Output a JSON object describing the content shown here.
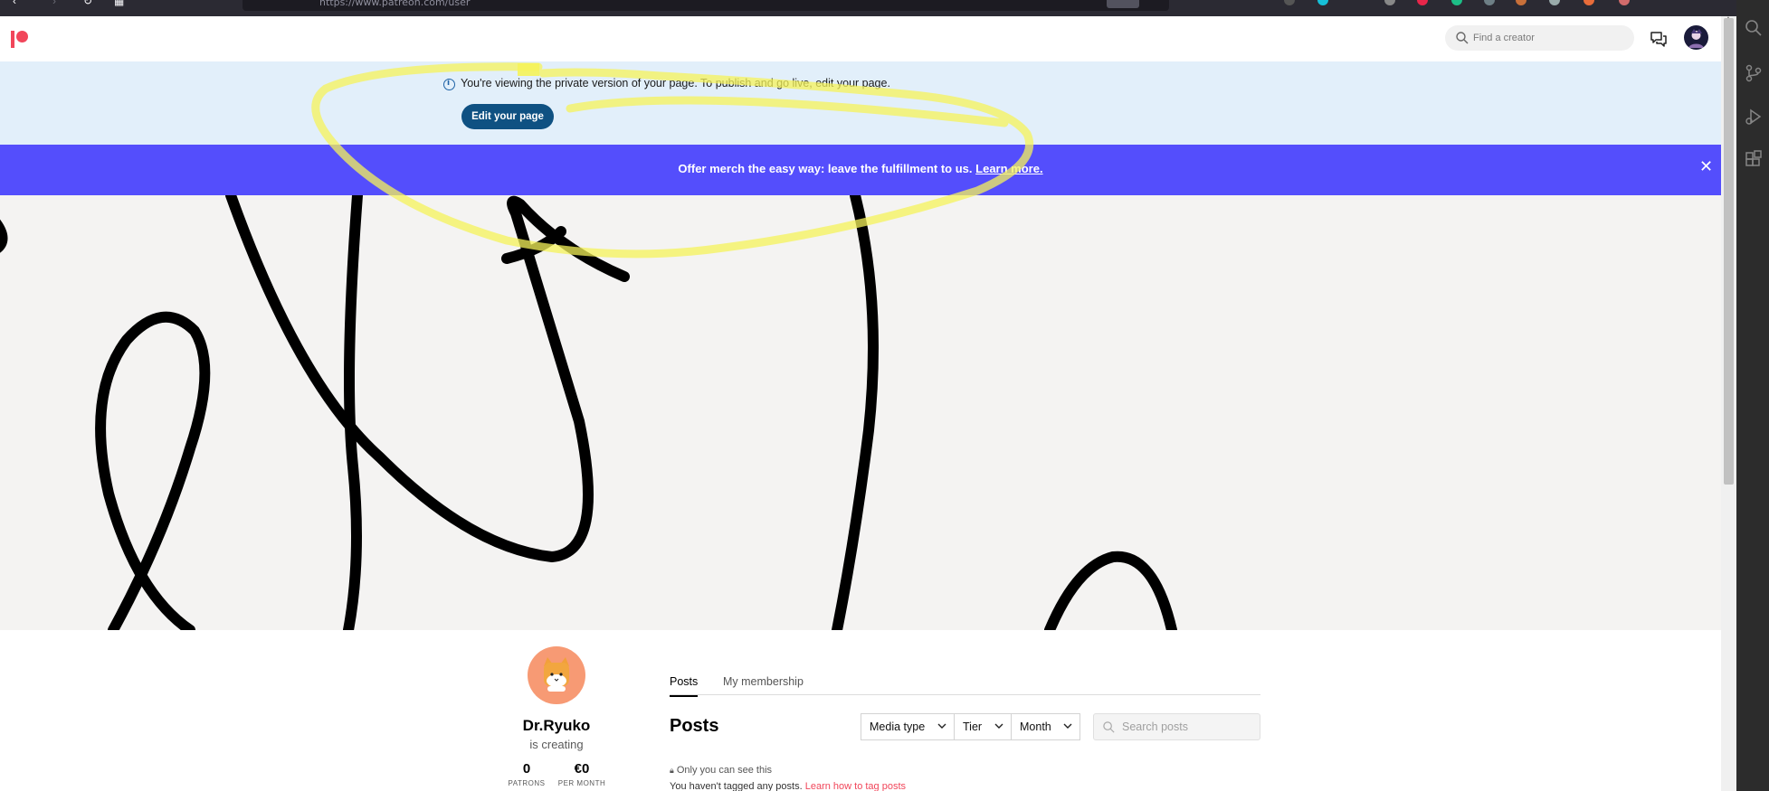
{
  "browser": {
    "url": "https://www.patreon.com/user",
    "zoom": "90%"
  },
  "topnav": {
    "search_placeholder": "Find a creator"
  },
  "private_banner": {
    "text": "You're viewing the private version of your page. To publish and go live,",
    "link_text": "edit your page",
    "period": ".",
    "button_label": "Edit your page"
  },
  "merch_banner": {
    "text": "Offer merch the easy way: leave the fulfillment to us.",
    "link_text": "Learn more.",
    "close_glyph": "✕"
  },
  "creator": {
    "name": "Dr.Ryuko",
    "subtitle": "is creating",
    "stats": [
      {
        "value": "0",
        "label": "PATRONS"
      },
      {
        "value": "€0",
        "label": "PER MONTH"
      }
    ]
  },
  "tabs": [
    {
      "label": "Posts",
      "active": true
    },
    {
      "label": "My membership",
      "active": false
    }
  ],
  "posts": {
    "heading": "Posts",
    "filters": [
      "Media type",
      "Tier",
      "Month"
    ],
    "search_placeholder": "Search posts",
    "visibility_note": "Only you can see this",
    "untagged_text": "You haven't tagged any posts.",
    "untagged_link": "Learn how to tag posts"
  },
  "colors": {
    "brand": "#f1465a",
    "merch_banner": "#544efc",
    "edit_button": "#0f5182",
    "private_banner": "#e2effa",
    "highlight": "#f5f35a"
  },
  "icons": [
    "search-icon",
    "chat-icon",
    "info-icon",
    "close-icon",
    "lock-icon",
    "chevron-down-icon"
  ]
}
